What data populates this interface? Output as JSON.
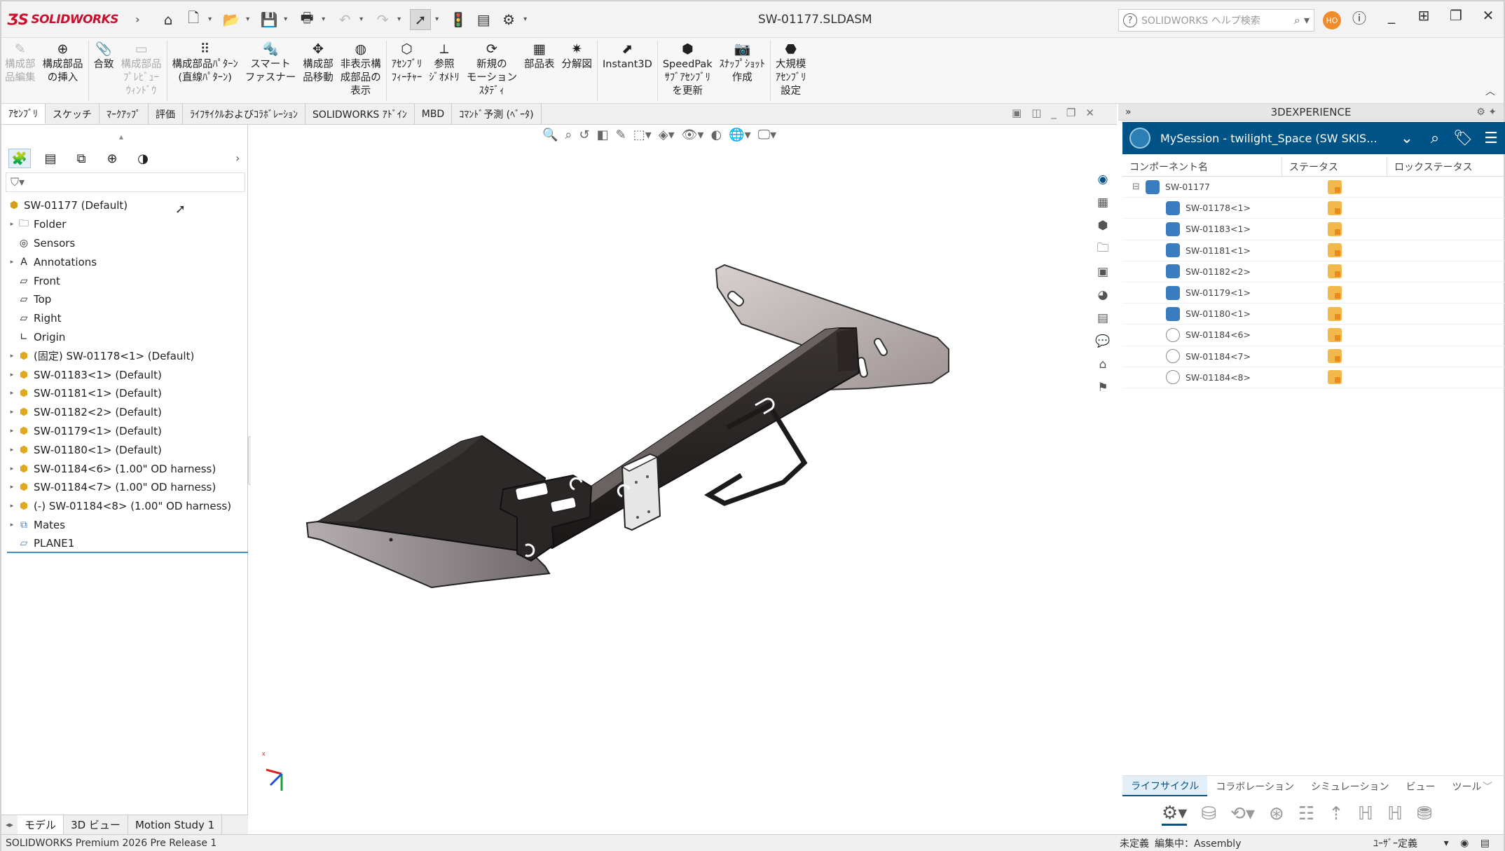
{
  "app": {
    "brand": "SOLIDWORKS",
    "document_title": "SW-01177.SLDASM",
    "search_placeholder": "SOLIDWORKS ヘルプ検索",
    "user_initials": "HO"
  },
  "ribbon": {
    "buttons": [
      {
        "label": "構成部\n品編集",
        "enabled": false,
        "icon": "edit-component-icon"
      },
      {
        "label": "構成部品\nの挿入",
        "enabled": true,
        "icon": "insert-component-icon"
      },
      {
        "label": "合致",
        "enabled": true,
        "icon": "mate-icon"
      },
      {
        "label": "構成部品\nﾌﾟﾚﾋﾞｭｰ\nｳｨﾝﾄﾞｳ",
        "enabled": false,
        "icon": "preview-window-icon"
      },
      {
        "label": "構成部品ﾊﾟﾀｰﾝ\n(直線ﾊﾟﾀｰﾝ)",
        "enabled": true,
        "icon": "linear-pattern-icon"
      },
      {
        "label": "スマート\nファスナー",
        "enabled": true,
        "icon": "smart-fastener-icon"
      },
      {
        "label": "構成部\n品移動",
        "enabled": true,
        "icon": "move-component-icon"
      },
      {
        "label": "非表示構\n成部品の\n表示",
        "enabled": true,
        "icon": "show-hidden-icon"
      },
      {
        "label": "ｱｾﾝﾌﾞﾘ\nﾌｨｰﾁｬｰ",
        "enabled": true,
        "icon": "assembly-feature-icon"
      },
      {
        "label": "参照\nｼﾞｵﾒﾄﾘ",
        "enabled": true,
        "icon": "reference-geometry-icon"
      },
      {
        "label": "新規の\nモーション\nｽﾀﾃﾞｨ",
        "enabled": true,
        "icon": "motion-study-icon"
      },
      {
        "label": "部品表",
        "enabled": true,
        "icon": "bom-icon"
      },
      {
        "label": "分解図",
        "enabled": true,
        "icon": "exploded-view-icon"
      },
      {
        "label": "Instant3D",
        "enabled": true,
        "icon": "instant3d-icon"
      },
      {
        "label": "SpeedPak\nｻﾌﾞｱｾﾝﾌﾞﾘ\nを更新",
        "enabled": true,
        "icon": "speedpak-icon"
      },
      {
        "label": "ｽﾅｯﾌﾟｼｮｯﾄ\n作成",
        "enabled": true,
        "icon": "snapshot-icon"
      },
      {
        "label": "大規模\nｱｾﾝﾌﾞﾘ\n設定",
        "enabled": true,
        "icon": "large-assembly-icon"
      }
    ]
  },
  "command_tabs": [
    "ｱｾﾝﾌﾞﾘ",
    "スケッチ",
    "ﾏｰｸｱｯﾌﾟ",
    "評価",
    "ﾗｲﾌｻｲｸﾙおよびｺﾗﾎﾞﾚｰｼｮﾝ",
    "SOLIDWORKS ｱﾄﾞｲﾝ",
    "MBD",
    "ｺﾏﾝﾄﾞ予測 (ﾍﾞｰﾀ)"
  ],
  "feature_tree": {
    "root": "SW-01177 (Default)",
    "nodes": [
      {
        "label": "Folder",
        "icon": "folder-icon",
        "expandable": true
      },
      {
        "label": "Sensors",
        "icon": "sensor-icon",
        "expandable": false
      },
      {
        "label": "Annotations",
        "icon": "annotation-icon",
        "expandable": true
      },
      {
        "label": "Front",
        "icon": "plane-icon",
        "expandable": false
      },
      {
        "label": "Top",
        "icon": "plane-icon",
        "expandable": false
      },
      {
        "label": "Right",
        "icon": "plane-icon",
        "expandable": false
      },
      {
        "label": "Origin",
        "icon": "origin-icon",
        "expandable": false
      },
      {
        "label": "(固定) SW-01178<1> (Default)",
        "icon": "part-icon",
        "expandable": true
      },
      {
        "label": "SW-01183<1> (Default)",
        "icon": "part-icon",
        "expandable": true
      },
      {
        "label": "SW-01181<1> (Default)",
        "icon": "part-icon",
        "expandable": true
      },
      {
        "label": "SW-01182<2> (Default)",
        "icon": "part-icon",
        "expandable": true
      },
      {
        "label": "SW-01179<1> (Default)",
        "icon": "part-icon",
        "expandable": true
      },
      {
        "label": "SW-01180<1> (Default)",
        "icon": "part-icon",
        "expandable": true
      },
      {
        "label": "SW-01184<6> (1.00\" OD harness)",
        "icon": "part-icon",
        "expandable": true
      },
      {
        "label": "SW-01184<7> (1.00\" OD harness)",
        "icon": "part-icon",
        "expandable": true
      },
      {
        "label": "(-) SW-01184<8> (1.00\" OD harness)",
        "icon": "part-icon",
        "expandable": true
      },
      {
        "label": "Mates",
        "icon": "mates-icon",
        "expandable": true
      },
      {
        "label": "PLANE1",
        "icon": "plane-icon",
        "expandable": false
      }
    ]
  },
  "xp_panel": {
    "header": "3DEXPERIENCE",
    "session": "MySession - twilight_Space (SW SKIS...",
    "columns": [
      "コンポーネント名",
      "ステータス",
      "ロックステータス"
    ],
    "rows": [
      {
        "name": "SW-01177",
        "indent": 0,
        "kind": "assembly"
      },
      {
        "name": "SW-01178<1>",
        "indent": 1,
        "kind": "part"
      },
      {
        "name": "SW-01183<1>",
        "indent": 1,
        "kind": "part"
      },
      {
        "name": "SW-01181<1>",
        "indent": 1,
        "kind": "part"
      },
      {
        "name": "SW-01182<2>",
        "indent": 1,
        "kind": "part"
      },
      {
        "name": "SW-01179<1>",
        "indent": 1,
        "kind": "part"
      },
      {
        "name": "SW-01180<1>",
        "indent": 1,
        "kind": "part"
      },
      {
        "name": "SW-01184<6>",
        "indent": 1,
        "kind": "harness"
      },
      {
        "name": "SW-01184<7>",
        "indent": 1,
        "kind": "harness"
      },
      {
        "name": "SW-01184<8>",
        "indent": 1,
        "kind": "harness"
      }
    ],
    "bottom_tabs": [
      "ライフサイクル",
      "コラボレーション",
      "シミュレーション",
      "ビュー",
      "ツール"
    ]
  },
  "model_tabs": [
    "モデル",
    "3D ビュー",
    "Motion Study 1"
  ],
  "status": {
    "left": "SOLIDWORKS Premium 2026 Pre Release 1",
    "state": "未定義",
    "editing": "編集中：Assembly",
    "units": "ﾕｰｻﾞｰ定義"
  }
}
